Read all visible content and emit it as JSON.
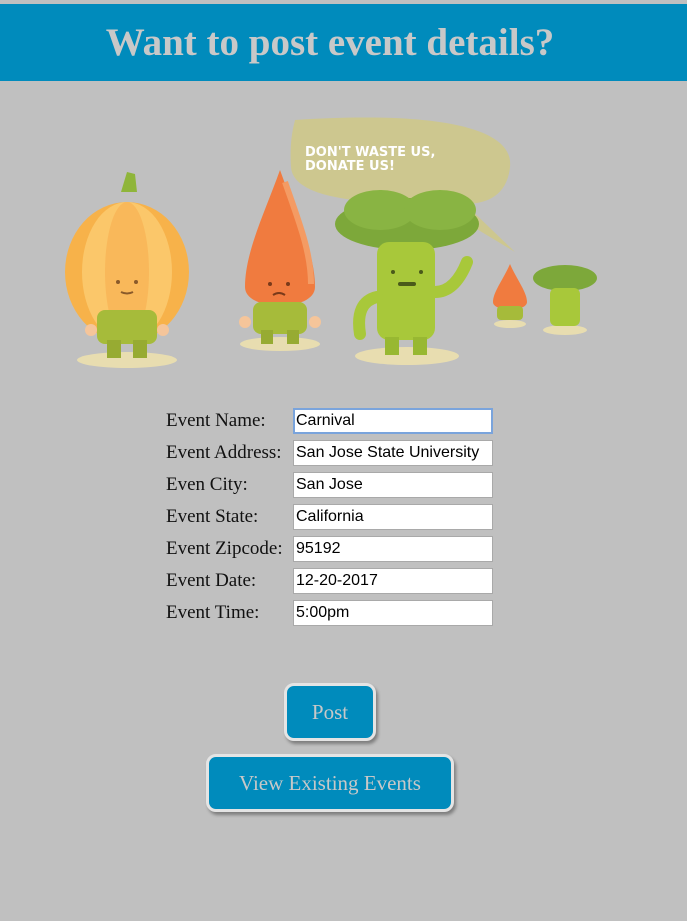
{
  "header": {
    "title": "Want to post event details?"
  },
  "illustration": {
    "speech_bubble_text": "DON'T WASTE US,\nDONATE US!",
    "speech_bubble_line1": "DON'T WASTE US,",
    "speech_bubble_line2": "DONATE US!"
  },
  "form": {
    "fields": [
      {
        "label": "Event Name:",
        "value": "Carnival"
      },
      {
        "label": "Event Address:",
        "value": "San Jose State University"
      },
      {
        "label": "Even City:",
        "value": "San Jose"
      },
      {
        "label": "Event State:",
        "value": "California"
      },
      {
        "label": "Event Zipcode:",
        "value": "95192"
      },
      {
        "label": "Event Date:",
        "value": "12-20-2017"
      },
      {
        "label": "Event Time:",
        "value": "5:00pm"
      }
    ]
  },
  "buttons": {
    "post_label": "Post",
    "view_label": "View Existing Events"
  },
  "colors": {
    "header_bg": "#008bbc",
    "page_bg": "#c0c0c0",
    "button_bg": "#008bbc",
    "title_text": "#c8c8c8"
  }
}
